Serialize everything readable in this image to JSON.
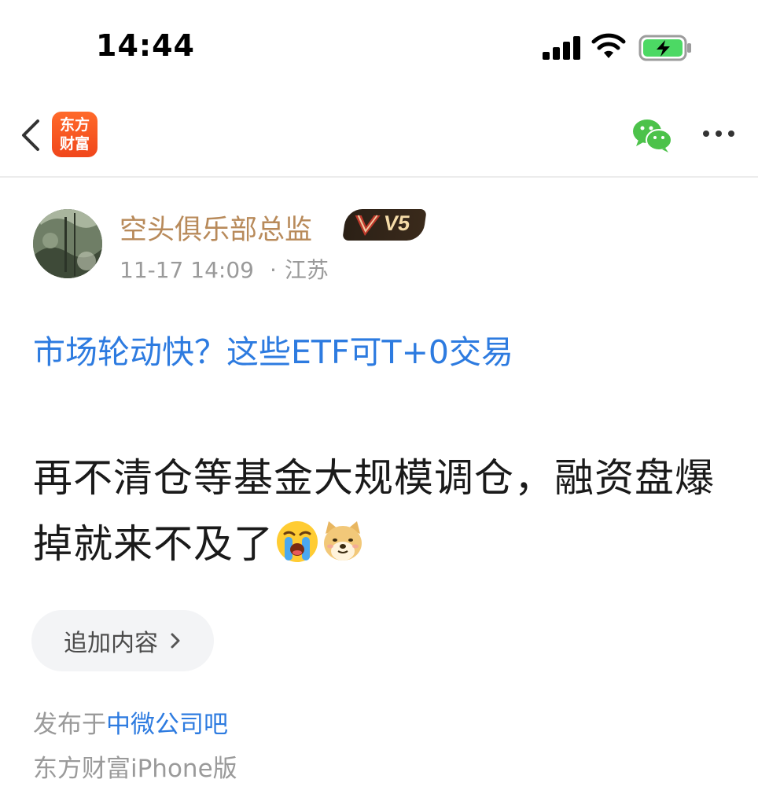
{
  "status_bar": {
    "time": "14:44"
  },
  "nav": {
    "logo_line1": "东方",
    "logo_line2": "财富"
  },
  "post": {
    "author": "空头俱乐部总监",
    "badge": "V5",
    "date": "11-17 14:09",
    "location": "江苏",
    "topic_link": "市场轮动快？这些ETF可T+0交易",
    "body": "再不清仓等基金大规模调仓，融资盘爆掉就来不及了",
    "emojis": [
      "crying-face-icon",
      "doge-face-icon"
    ],
    "add_content_label": "追加内容",
    "published_prefix": "发布于",
    "published_bar": "中微公司吧",
    "client": "东方财富iPhone版"
  },
  "colors": {
    "link_blue": "#2d7be0",
    "author_gold": "#b88a5a",
    "brand_orange": "#f0461b",
    "wechat_green": "#4cc24a",
    "battery_green": "#4cd964"
  }
}
